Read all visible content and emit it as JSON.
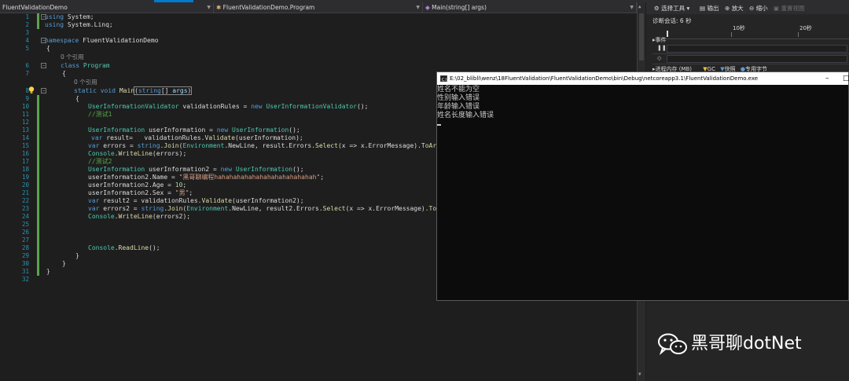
{
  "navbar": {
    "project": "FluentValidationDemo",
    "class_path": "FluentValidationDemo.Program",
    "member": "Main(string[] args)"
  },
  "editor": {
    "line_numbers": [
      "1",
      "2",
      "3",
      "4",
      "5",
      "",
      "6",
      "7",
      "",
      "8",
      "9",
      "10",
      "11",
      "12",
      "13",
      "14",
      "15",
      "16",
      "17",
      "18",
      "19",
      "20",
      "21",
      "22",
      "23",
      "24",
      "25",
      "26",
      "27",
      "28",
      "29",
      "30",
      "31",
      "32"
    ],
    "codelens_refs": "0 个引用",
    "codelens_refs2": "0 个引用",
    "lines": {
      "l1": [
        "using",
        " System;"
      ],
      "l2": [
        "using",
        " System.Linq;"
      ],
      "l4": [
        "namespace",
        " FluentValidationDemo"
      ],
      "l5": "{",
      "l6": [
        "class",
        " Program"
      ],
      "l7": "{",
      "l8": [
        "static",
        "void",
        "Main",
        "(",
        "string",
        "[] ",
        "args",
        ")"
      ],
      "l9": "{",
      "l10": [
        "UserInformationValidator",
        " validationRules = ",
        "new",
        " ",
        "UserInformationValidator",
        "();"
      ],
      "l11": "//测试1",
      "l13": [
        "UserInformation",
        " userInformation = ",
        "new",
        " ",
        "UserInformation",
        "();"
      ],
      "l14": [
        "var",
        " result=   validationRules.",
        "Validate",
        "(userInformation);"
      ],
      "l15": [
        "var",
        " errors = ",
        "string",
        ".",
        "Join",
        "(",
        "Environment",
        ".NewLine, result.Errors.",
        "Select",
        "(x => x.ErrorMessage).",
        "ToArray",
        "());"
      ],
      "l16": [
        "Console",
        ".",
        "WriteLine",
        "(errors);"
      ],
      "l17": "//测试2",
      "l18": [
        "UserInformation",
        " userInformation2 = ",
        "new",
        " ",
        "UserInformation",
        "();"
      ],
      "l19": [
        "userInformation2.Name = ",
        "\"黑哥聊编程hahahahahahahahahahahahahah\"",
        ";"
      ],
      "l20": [
        "userInformation2.Age = ",
        "10",
        ";"
      ],
      "l21": [
        "userInformation2.Sex = ",
        "\"男\"",
        ";"
      ],
      "l22": [
        "var",
        " result2 = validationRules.",
        "Validate",
        "(userInformation2);"
      ],
      "l23": [
        "var",
        " errors2 = ",
        "string",
        ".",
        "Join",
        "(",
        "Environment",
        ".NewLine, result2.Errors.",
        "Select",
        "(x => x.ErrorMessage).",
        "ToArray",
        "());"
      ],
      "l24": [
        "Console",
        ".",
        "WriteLine",
        "(errors2);"
      ],
      "l28": [
        "Console",
        ".",
        "ReadLine",
        "();"
      ],
      "l29": "}",
      "l30": "}",
      "l31": "}"
    }
  },
  "diagnostics": {
    "toolbar": {
      "select_tools": "选择工具",
      "output": "输出",
      "zoom_in": "放大",
      "zoom_out": "缩小",
      "reset_view": "重置视图"
    },
    "session": "诊断会话: 6 秒",
    "timeline_ticks": [
      "10秒",
      "20秒"
    ],
    "events_label": "▸事件",
    "process_memory_label": "▸进程内存 (MB)",
    "gc_label": "GC",
    "snapshot_label": "快照",
    "private_bytes_label": "专用字节"
  },
  "console": {
    "title": "E:\\02_blibli\\wenz\\18FluentValidation\\FluentValidationDemo\\bin\\Debug\\netcoreapp3.1\\FluentValidationDemo.exe",
    "output": [
      "姓名不能为空",
      "性别输入错误",
      "年龄输入错误",
      "姓名长度输入错误"
    ]
  },
  "watermark": {
    "text": "黑哥聊dotNet"
  },
  "colors": {
    "editor_bg": "#1e1e1e",
    "keyword": "#569cd6",
    "type": "#4ec9b0",
    "string": "#d69d85",
    "comment": "#57a64a",
    "line_number": "#2b91af",
    "change_marker": "#57a64a"
  }
}
